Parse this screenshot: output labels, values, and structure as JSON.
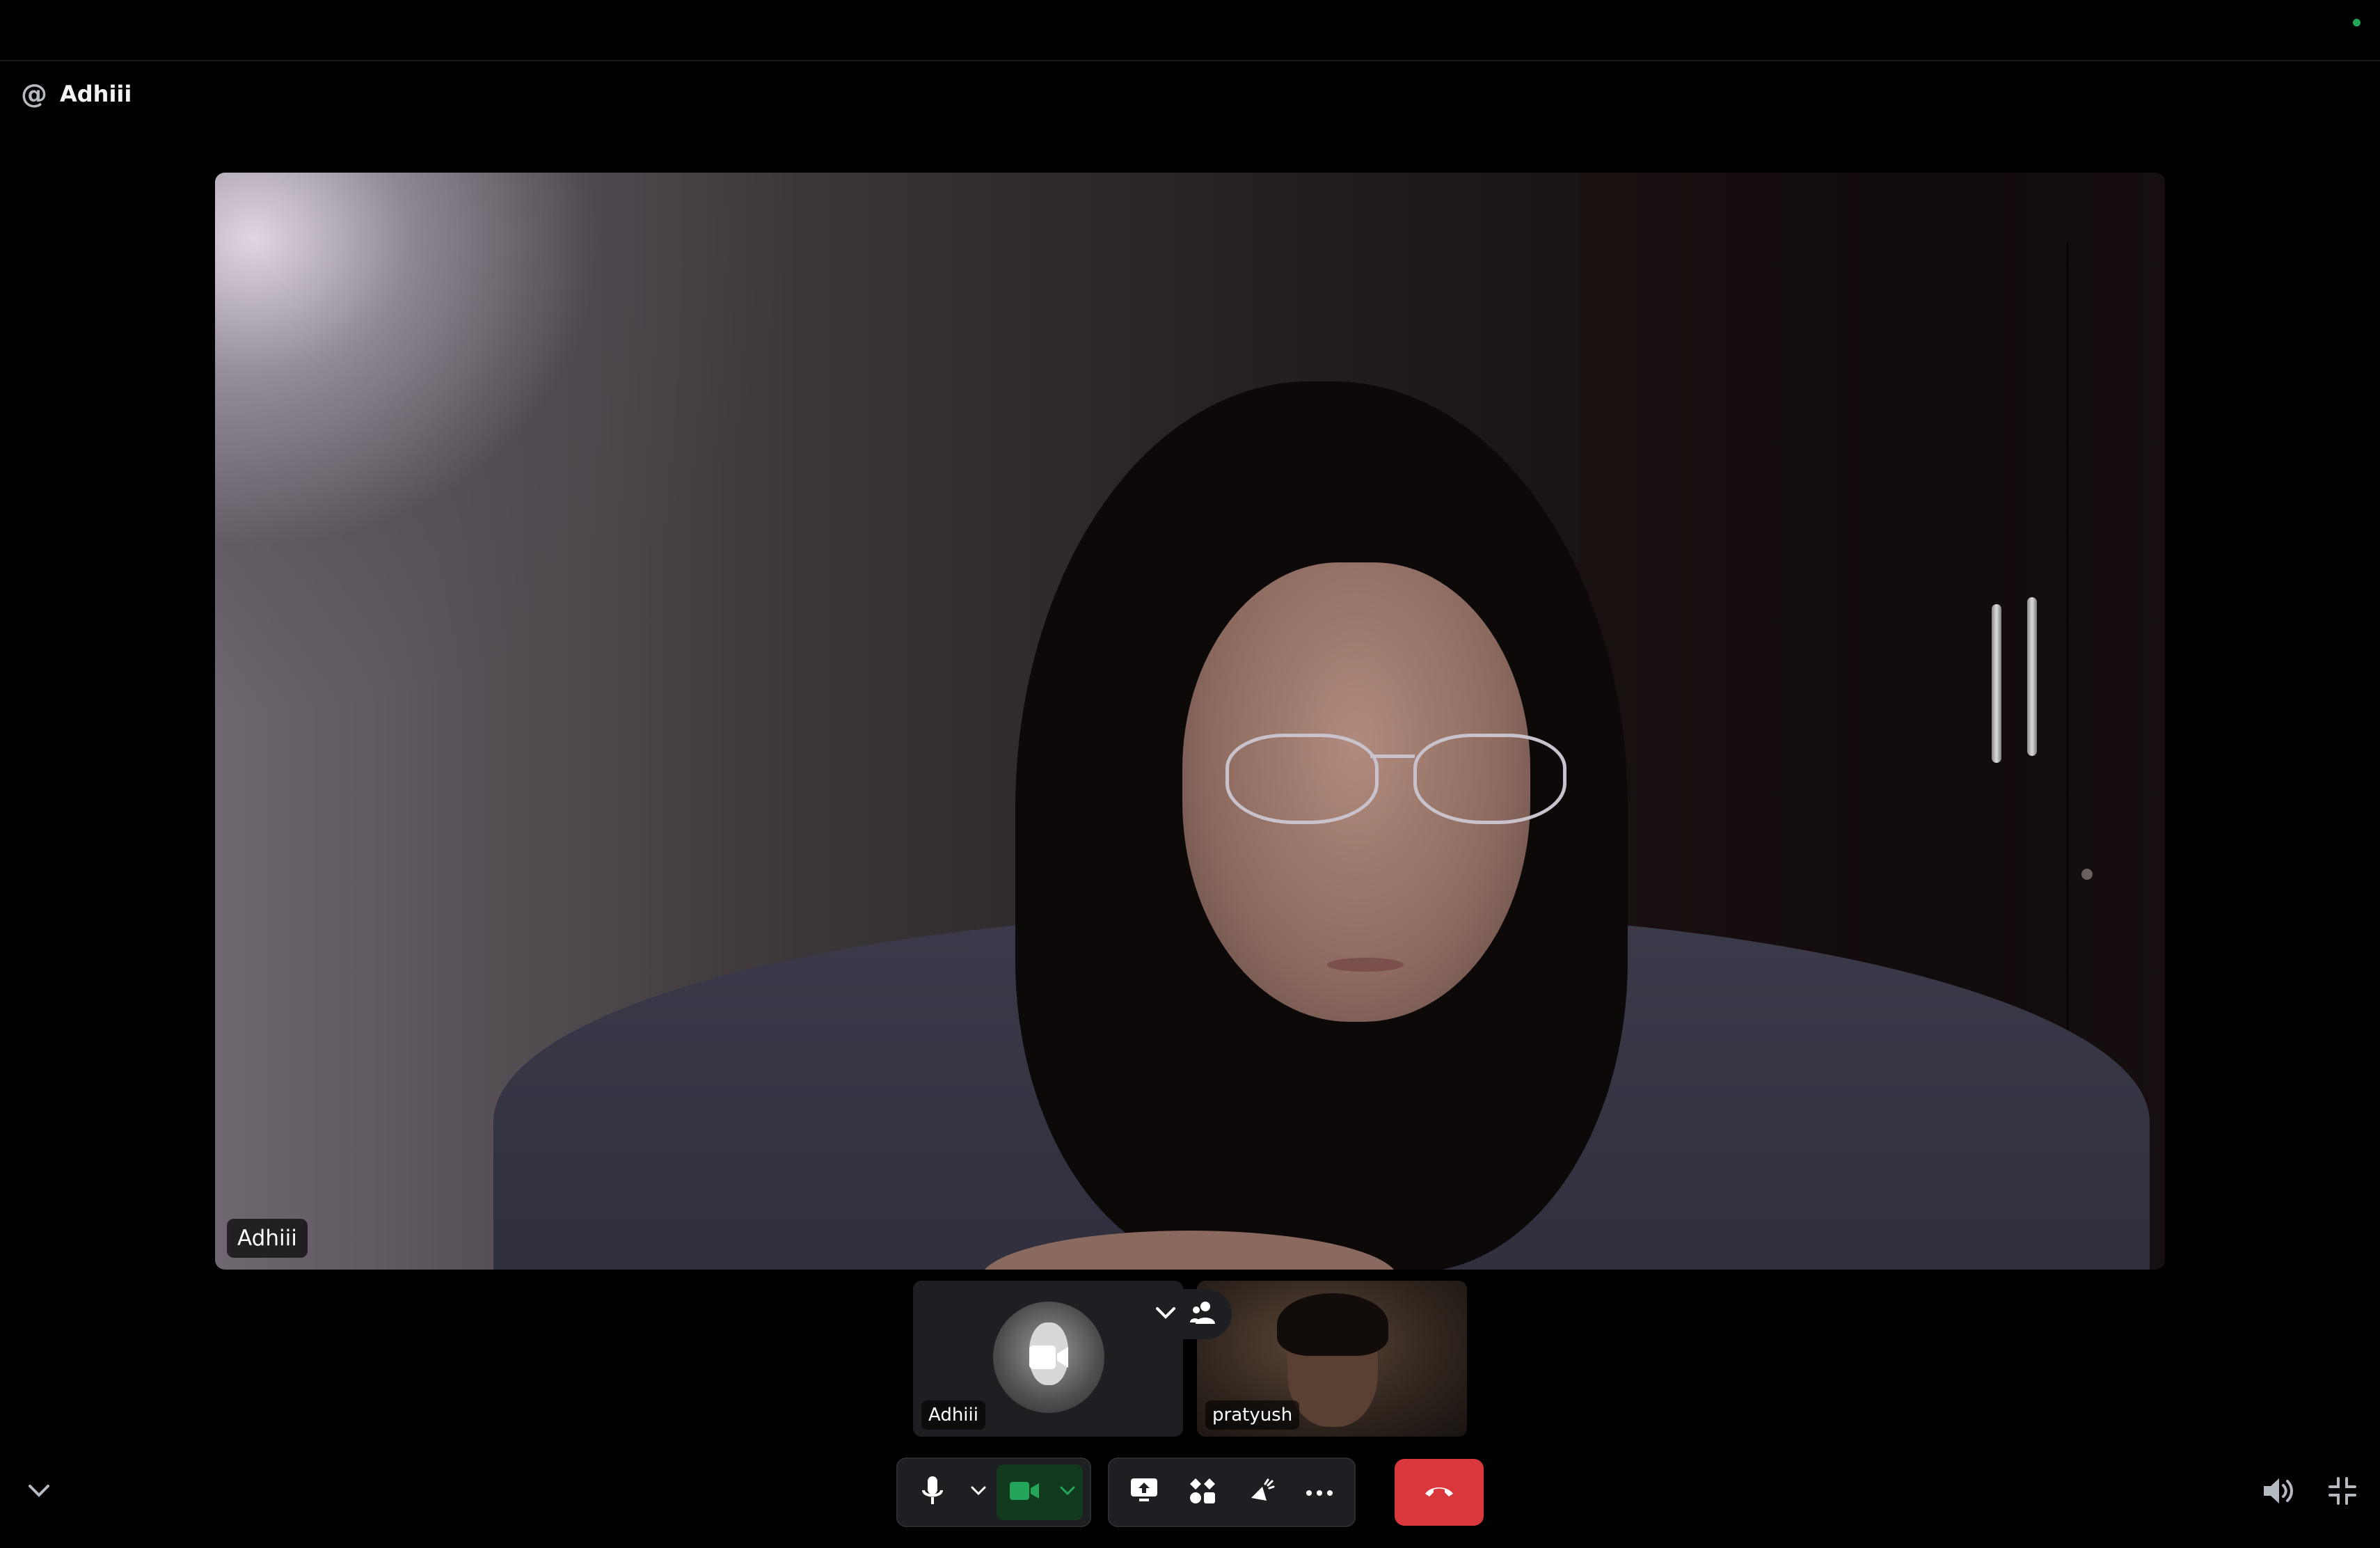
{
  "window": {
    "status_color": "#23a55a"
  },
  "header": {
    "icon": "at-icon",
    "at_symbol": "@",
    "channel_name": "Adhiii"
  },
  "main_video": {
    "participant_name": "Adhiii"
  },
  "participants": [
    {
      "name": "Adhiii",
      "video": "off",
      "icon": "video-camera-icon"
    },
    {
      "name": "pratyush",
      "video": "on"
    }
  ],
  "participants_toggle": {
    "icons": [
      "chevron-down-icon",
      "people-icon"
    ]
  },
  "controls": {
    "mic": {
      "icon": "microphone-icon",
      "dropdown": "chevron-down-icon"
    },
    "camera": {
      "icon": "video-camera-icon",
      "dropdown": "chevron-down-icon",
      "state": "on",
      "color": "#23a55a"
    },
    "screen_share": {
      "icon": "screen-share-icon"
    },
    "activities": {
      "icon": "activities-icon"
    },
    "soundboard": {
      "icon": "soundboard-icon"
    },
    "more": {
      "icon": "more-icon"
    },
    "end_call": {
      "icon": "phone-hangup-icon",
      "color": "#da373c"
    }
  },
  "bottom_left": {
    "icon": "chevron-down-icon"
  },
  "bottom_right": {
    "volume_icon": "volume-icon",
    "fullscreen_icon": "exit-fullscreen-icon"
  }
}
